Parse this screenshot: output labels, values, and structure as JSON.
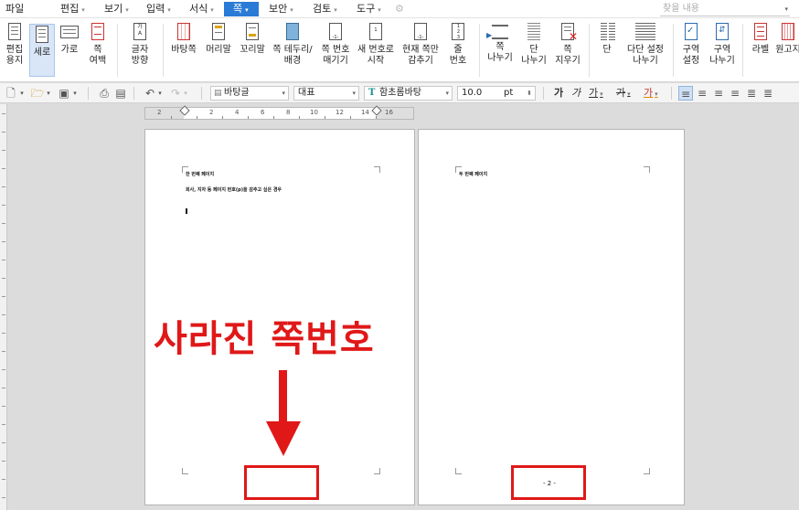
{
  "menubar": {
    "items": [
      {
        "label": "파일",
        "has_caret": false
      },
      {
        "label": "편집",
        "has_caret": true
      },
      {
        "label": "보기",
        "has_caret": true
      },
      {
        "label": "입력",
        "has_caret": true
      },
      {
        "label": "서식",
        "has_caret": true
      },
      {
        "label": "쪽",
        "has_caret": true,
        "active": true
      },
      {
        "label": "보안",
        "has_caret": true
      },
      {
        "label": "검토",
        "has_caret": true
      },
      {
        "label": "도구",
        "has_caret": true
      }
    ],
    "search_placeholder": "찾을 내용"
  },
  "ribbon": {
    "buttons": [
      {
        "label": "편집\n용지",
        "icon": "page-setup-icon"
      },
      {
        "label": "세로",
        "icon": "portrait-icon",
        "selected": true
      },
      {
        "label": "가로",
        "icon": "landscape-icon"
      },
      {
        "label": "쪽\n여백",
        "icon": "margins-icon",
        "dropdown": true
      },
      {
        "label": "글자\n방향",
        "icon": "text-direction-icon",
        "dropdown": true
      },
      {
        "label": "바탕쪽",
        "icon": "master-page-icon"
      },
      {
        "label": "머리말",
        "icon": "header-icon",
        "dropdown": true
      },
      {
        "label": "꼬리말",
        "icon": "footer-icon",
        "dropdown": true
      },
      {
        "label": "쪽 테두리/\n배경",
        "icon": "page-border-icon"
      },
      {
        "label": "쪽 번호\n매기기",
        "icon": "page-number-icon"
      },
      {
        "label": "새 번호로\n시작",
        "icon": "new-number-icon"
      },
      {
        "label": "현재 쪽만\n감추기",
        "icon": "hide-page-icon"
      },
      {
        "label": "줄\n번호",
        "icon": "line-number-icon",
        "dropdown": true
      },
      {
        "label": "쪽\n나누기",
        "icon": "page-break-icon"
      },
      {
        "label": "단\n나누기",
        "icon": "column-break-icon"
      },
      {
        "label": "쪽\n지우기",
        "icon": "delete-page-icon"
      },
      {
        "label": "단",
        "icon": "columns-icon",
        "dropdown": true
      },
      {
        "label": "다단 설정\n나누기",
        "icon": "multi-column-icon"
      },
      {
        "label": "구역\n설정",
        "icon": "section-setup-icon"
      },
      {
        "label": "구역\n나누기",
        "icon": "section-break-icon"
      },
      {
        "label": "라벨",
        "icon": "label-icon",
        "dropdown": true
      },
      {
        "label": "원고지",
        "icon": "manuscript-icon"
      }
    ]
  },
  "toolbar": {
    "style": "바탕글",
    "representative": "대표",
    "font": "함초롬바탕",
    "font_icon": "T",
    "size": "10.0",
    "unit": "pt",
    "bold": "가",
    "italic": "가",
    "underline": "가",
    "strike": "가",
    "color": "가"
  },
  "ruler": {
    "labels": [
      "2",
      "2",
      "4",
      "6",
      "8",
      "10",
      "12",
      "14",
      "16"
    ]
  },
  "document": {
    "page1": {
      "line1": "한 번째 페이지",
      "line2": "회사, 지자 등 페이지 번호(p)을 감추고 싶은 경우",
      "page_number": ""
    },
    "page2": {
      "line1": "두 번째 페이지",
      "page_number": "- 2 -"
    }
  },
  "annotation": {
    "callout": "사라진 쪽번호",
    "color": "#e01818"
  }
}
